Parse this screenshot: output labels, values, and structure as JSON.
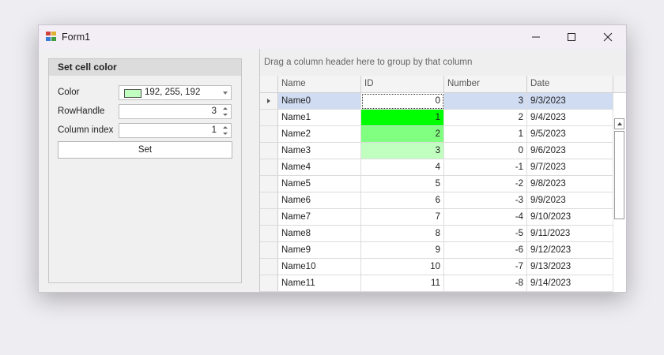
{
  "window": {
    "title": "Form1"
  },
  "panel": {
    "title": "Set cell color",
    "color": {
      "label": "Color",
      "value": "192, 255, 192",
      "swatch": "#c0ffc0"
    },
    "row_handle": {
      "label": "RowHandle",
      "value": "3"
    },
    "column_index": {
      "label": "Column index",
      "value": "1"
    },
    "set_button": "Set"
  },
  "grid": {
    "group_panel_text": "Drag a column header here to group by that column",
    "columns": [
      "Name",
      "ID",
      "Number",
      "Date"
    ],
    "focused_row": 0,
    "rows": [
      {
        "name": "Name0",
        "id": "0",
        "number": "3",
        "date": "9/3/2023",
        "id_color": ""
      },
      {
        "name": "Name1",
        "id": "1",
        "number": "2",
        "date": "9/4/2023",
        "id_color": "#00ff00"
      },
      {
        "name": "Name2",
        "id": "2",
        "number": "1",
        "date": "9/5/2023",
        "id_color": "#80ff80"
      },
      {
        "name": "Name3",
        "id": "3",
        "number": "0",
        "date": "9/6/2023",
        "id_color": "#c0ffc0"
      },
      {
        "name": "Name4",
        "id": "4",
        "number": "-1",
        "date": "9/7/2023",
        "id_color": ""
      },
      {
        "name": "Name5",
        "id": "5",
        "number": "-2",
        "date": "9/8/2023",
        "id_color": ""
      },
      {
        "name": "Name6",
        "id": "6",
        "number": "-3",
        "date": "9/9/2023",
        "id_color": ""
      },
      {
        "name": "Name7",
        "id": "7",
        "number": "-4",
        "date": "9/10/2023",
        "id_color": ""
      },
      {
        "name": "Name8",
        "id": "8",
        "number": "-5",
        "date": "9/11/2023",
        "id_color": ""
      },
      {
        "name": "Name9",
        "id": "9",
        "number": "-6",
        "date": "9/12/2023",
        "id_color": ""
      },
      {
        "name": "Name10",
        "id": "10",
        "number": "-7",
        "date": "9/13/2023",
        "id_color": ""
      },
      {
        "name": "Name11",
        "id": "11",
        "number": "-8",
        "date": "9/14/2023",
        "id_color": ""
      }
    ]
  },
  "icons": {
    "app": "app-icon",
    "minimize": "minimize-icon",
    "maximize": "maximize-icon",
    "close": "close-icon",
    "row_indicator": "row-indicator-arrow-icon"
  },
  "colors": {
    "focused_row": "#d0dcf2",
    "titlebar": "#f3eef6"
  }
}
